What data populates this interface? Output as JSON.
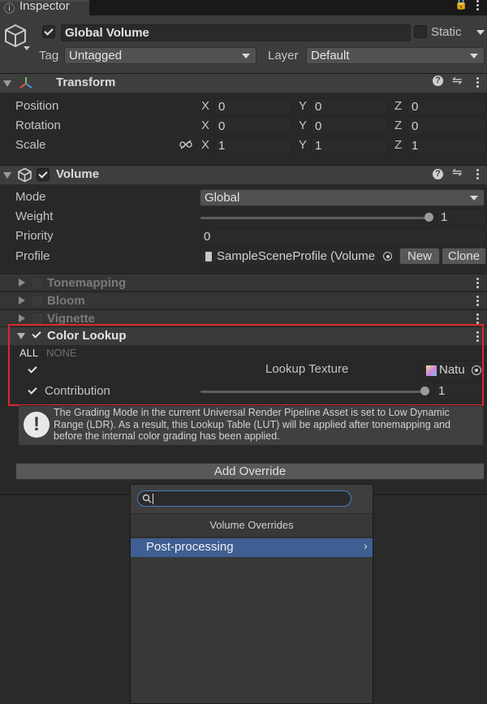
{
  "tab": {
    "label": "Inspector"
  },
  "object": {
    "name": "Global Volume",
    "static_label": "Static",
    "tag_label": "Tag",
    "tag_value": "Untagged",
    "layer_label": "Layer",
    "layer_value": "Default"
  },
  "transform": {
    "title": "Transform",
    "position": {
      "label": "Position",
      "x": "0",
      "y": "0",
      "z": "0"
    },
    "rotation": {
      "label": "Rotation",
      "x": "0",
      "y": "0",
      "z": "0"
    },
    "scale": {
      "label": "Scale",
      "x": "1",
      "y": "1",
      "z": "1"
    },
    "axis_x": "X",
    "axis_y": "Y",
    "axis_z": "Z"
  },
  "volume": {
    "title": "Volume",
    "mode_label": "Mode",
    "mode_value": "Global",
    "weight_label": "Weight",
    "weight_value": "1",
    "weight_fraction": 1.0,
    "priority_label": "Priority",
    "priority_value": "0",
    "profile_label": "Profile",
    "profile_value": "SampleSceneProfile (Volume",
    "new_button": "New",
    "clone_button": "Clone"
  },
  "overrides": [
    {
      "name": "Tonemapping"
    },
    {
      "name": "Bloom"
    },
    {
      "name": "Vignette"
    }
  ],
  "color_lookup": {
    "title": "Color Lookup",
    "all_label": "ALL",
    "none_label": "NONE",
    "lookup_texture_label": "Lookup Texture",
    "lookup_texture_value": "Natu",
    "contribution_label": "Contribution",
    "contribution_value": "1",
    "contribution_fraction": 1.0
  },
  "help_box": {
    "text": "The Grading Mode in the current Universal Render Pipeline Asset is set to Low Dynamic Range (LDR). As a result, this Lookup Table (LUT) will be applied after tonemapping and before the internal color grading has been applied."
  },
  "add_override": {
    "label": "Add Override"
  },
  "dropdown": {
    "search_value": "",
    "section_title": "Volume Overrides",
    "items": [
      {
        "label": "Post-processing"
      }
    ]
  },
  "colors": {
    "highlight_border": "#e0252c",
    "selected_item": "#3f5f93",
    "panel_bg": "#282828"
  }
}
